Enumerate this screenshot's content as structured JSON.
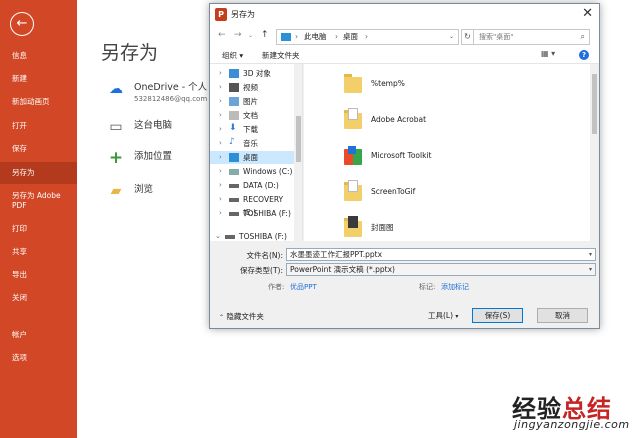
{
  "sidebar": {
    "back_icon": "arrow-left-icon",
    "items": [
      "信息",
      "新建",
      "新加动画页",
      "打开",
      "保存",
      "另存为",
      "另存为 Adobe\nPDF",
      "打印",
      "共享",
      "导出",
      "关闭",
      "帐户",
      "选项"
    ]
  },
  "main": {
    "title": "另存为",
    "onedrive_label": "OneDrive - 个人",
    "onedrive_email": "532812486@qq.com",
    "this_pc": "这台电脑",
    "add_place": "添加位置",
    "browse": "浏览"
  },
  "dialog": {
    "title": "另存为",
    "close": "✕",
    "address": [
      "此电脑",
      "桌面"
    ],
    "search_placeholder": "搜索\"桌面\"",
    "toolbar": {
      "organize": "组织 ▾",
      "new_folder": "新建文件夹"
    },
    "tree": [
      "3D 对象",
      "视频",
      "图片",
      "文档",
      "下载",
      "音乐",
      "桌面",
      "Windows (C:)",
      "DATA (D:)",
      "RECOVERY (E:)",
      "TOSHIBA (F:)",
      "TOSHIBA (F:)"
    ],
    "files": [
      "%temp%",
      "Adobe Acrobat",
      "Microsoft Toolkit",
      "ScreenToGif",
      "封面图"
    ],
    "filename_label": "文件名(N):",
    "filename": "水墨墨迹工作汇报PPT.pptx",
    "savetype_label": "保存类型(T):",
    "savetype": "PowerPoint 演示文稿 (*.pptx)",
    "author_label": "作者:",
    "author": "优品PPT",
    "tags_label": "标记:",
    "tags": "添加标记",
    "hide_folders": "隐藏文件夹",
    "tools": "工具(L)",
    "save": "保存(S)",
    "cancel": "取消"
  },
  "colors": {
    "accent": "#d24726",
    "active": "#b33a1c",
    "link": "#1e6fd9"
  },
  "watermark": {
    "part1": "经验",
    "part2": "总结",
    "url": "jingyanzongjie.com"
  }
}
